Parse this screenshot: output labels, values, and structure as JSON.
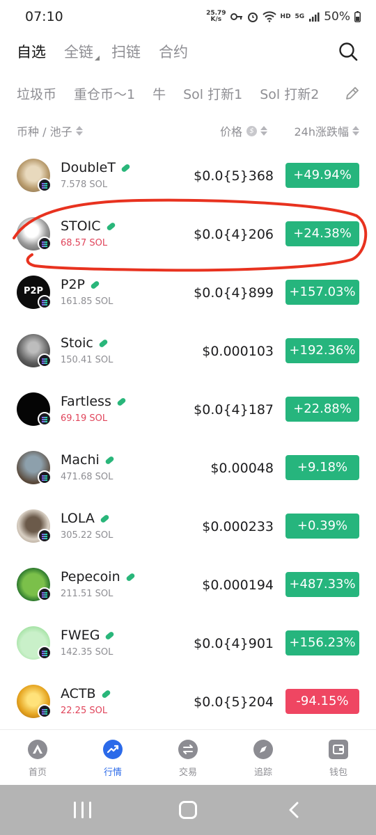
{
  "status_bar": {
    "time": "07:10",
    "net_speed_value": "25.79",
    "net_speed_unit": "K/s",
    "hd_label": "HD",
    "network_label": "5G",
    "battery": "50%"
  },
  "top_tabs": [
    {
      "label": "自选",
      "active": true
    },
    {
      "label": "全链",
      "active": false
    },
    {
      "label": "扫链",
      "active": false
    },
    {
      "label": "合约",
      "active": false
    }
  ],
  "category_tabs": [
    "垃圾币",
    "重仓币～1",
    "牛",
    "Sol 打新1",
    "Sol 打新2"
  ],
  "columns": {
    "coin_pool": "币种 / 池子",
    "price": "价格",
    "price_currency_icon": "$",
    "change_24h": "24h涨跌幅"
  },
  "tokens": [
    {
      "name": "DoubleT",
      "liquidity": "7.578 SOL",
      "liquidity_low": false,
      "price": "$0.0{5}368",
      "change": "+49.94%",
      "direction": "up",
      "avatar": "tan"
    },
    {
      "name": "STOIC",
      "liquidity": "68.57 SOL",
      "liquidity_low": true,
      "price": "$0.0{4}206",
      "change": "+24.38%",
      "direction": "up",
      "avatar": "sketch"
    },
    {
      "name": "P2P",
      "liquidity": "161.85 SOL",
      "liquidity_low": false,
      "price": "$0.0{4}899",
      "change": "+157.03%",
      "direction": "up",
      "avatar": "black-text",
      "avatar_text": "P2P"
    },
    {
      "name": "Stoic",
      "liquidity": "150.41 SOL",
      "liquidity_low": false,
      "price": "$0.000103",
      "change": "+192.36%",
      "direction": "up",
      "avatar": "grey"
    },
    {
      "name": "Fartless",
      "liquidity": "69.19 SOL",
      "liquidity_low": true,
      "price": "$0.0{4}187",
      "change": "+22.88%",
      "direction": "up",
      "avatar": "black"
    },
    {
      "name": "Machi",
      "liquidity": "471.68 SOL",
      "liquidity_low": false,
      "price": "$0.00048",
      "change": "+9.18%",
      "direction": "up",
      "avatar": "photo"
    },
    {
      "name": "LOLA",
      "liquidity": "305.22 SOL",
      "liquidity_low": false,
      "price": "$0.000233",
      "change": "+0.39%",
      "direction": "up",
      "avatar": "otter"
    },
    {
      "name": "Pepecoin",
      "liquidity": "211.51 SOL",
      "liquidity_low": false,
      "price": "$0.000194",
      "change": "+487.33%",
      "direction": "up",
      "avatar": "pepe"
    },
    {
      "name": "FWEG",
      "liquidity": "142.35 SOL",
      "liquidity_low": false,
      "price": "$0.0{4}901",
      "change": "+156.23%",
      "direction": "up",
      "avatar": "frog"
    },
    {
      "name": "ACTB",
      "liquidity": "22.25 SOL",
      "liquidity_low": true,
      "price": "$0.0{5}204",
      "change": "-94.15%",
      "direction": "down",
      "avatar": "gold"
    }
  ],
  "bottom_nav": [
    {
      "label": "首页",
      "icon": "home-icon",
      "active": false
    },
    {
      "label": "行情",
      "icon": "market-chart-icon",
      "active": true
    },
    {
      "label": "交易",
      "icon": "swap-icon",
      "active": false
    },
    {
      "label": "追踪",
      "icon": "compass-icon",
      "active": false
    },
    {
      "label": "钱包",
      "icon": "wallet-icon",
      "active": false
    }
  ],
  "colors": {
    "up": "#26b57d",
    "down": "#ef4662",
    "accent": "#2b6ae9",
    "low_liquidity_text": "#e0455b",
    "annotation": "#e8321f"
  }
}
